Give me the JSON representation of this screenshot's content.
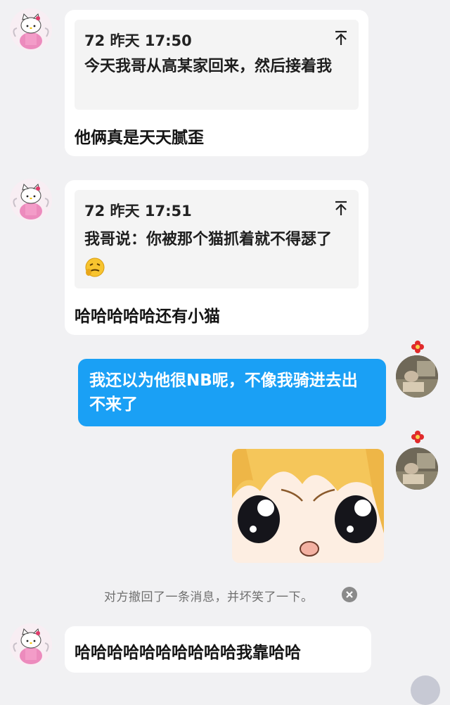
{
  "messages": [
    {
      "quote": {
        "meta": "72 昨天 17:50",
        "text": "今天我哥从高某家回来，然后接着我"
      },
      "text": "他俩真是天天腻歪"
    },
    {
      "quote": {
        "meta": "72 昨天 17:51",
        "text": "我哥说：你被那个猫抓着就不得瑟了"
      },
      "text": "哈哈哈哈哈还有小猫"
    }
  ],
  "sent_message": {
    "text": "我还以为他很NB呢，不像我骑进去出不来了"
  },
  "system_notice": "对方撤回了一条消息，并坏笑了一下。",
  "last_message": {
    "text": "哈哈哈哈哈哈哈哈哈哈我靠哈哈"
  },
  "icons": {
    "pin": "pin-to-top-icon",
    "emoji": "smirk-emoji-icon",
    "close": "close-circle-icon",
    "decor": "red-flower-icon"
  },
  "colors": {
    "background": "#f1f1f3",
    "sent_bubble": "#1aa0f5",
    "received_bubble": "#ffffff",
    "quote_box": "#f4f4f4"
  }
}
